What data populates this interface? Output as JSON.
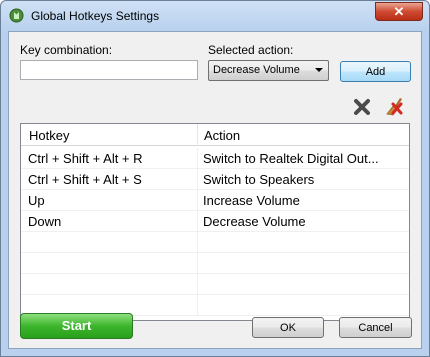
{
  "window": {
    "title": "Global Hotkeys Settings",
    "close_glyph": "✕"
  },
  "form": {
    "key_combination_label": "Key combination:",
    "key_combination_value": "",
    "selected_action_label": "Selected action:",
    "selected_action_value": "Decrease Volume",
    "add_label": "Add"
  },
  "toolbar": {
    "delete_icon": "delete-icon",
    "clear_icon": "clear-all-icon"
  },
  "table": {
    "columns": [
      "Hotkey",
      "Action"
    ],
    "rows": [
      {
        "hotkey": "Ctrl + Shift + Alt + R",
        "action": "Switch to Realtek Digital Out..."
      },
      {
        "hotkey": "Ctrl + Shift + Alt + S",
        "action": "Switch to Speakers"
      },
      {
        "hotkey": "Up",
        "action": "Increase Volume"
      },
      {
        "hotkey": "Down",
        "action": "Decrease Volume"
      }
    ]
  },
  "footer": {
    "start_label": "Start",
    "ok_label": "OK",
    "cancel_label": "Cancel"
  },
  "colors": {
    "start_green": "#3db52c",
    "close_red": "#cf4a32",
    "title_bg": "#b9d1ee"
  }
}
